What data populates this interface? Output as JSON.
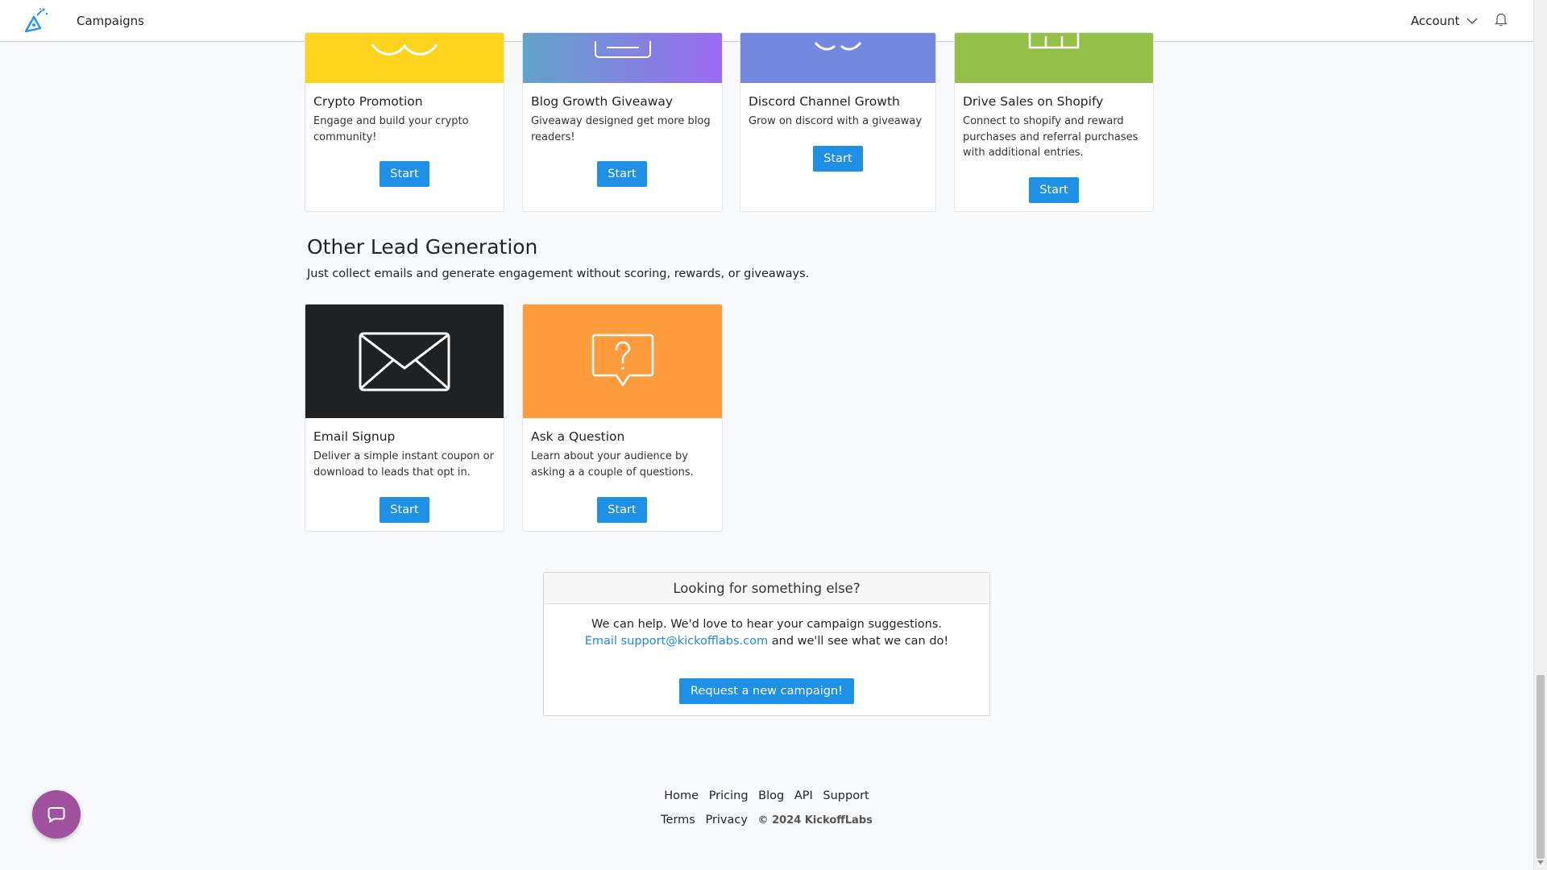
{
  "nav": {
    "campaigns": "Campaigns",
    "account": "Account"
  },
  "top_cards": [
    {
      "title": "Crypto Promotion",
      "desc": "Engage and build your crypto community!",
      "button": "Start",
      "color": "#fdd31c"
    },
    {
      "title": "Blog Growth Giveaway",
      "desc": "Giveaway designed get more blog readers!",
      "button": "Start",
      "color_from": "#62a3c9",
      "color_to": "#9b6bf2"
    },
    {
      "title": "Discord Channel Growth",
      "desc": "Grow on discord with a giveaway",
      "button": "Start",
      "color": "#7389e0"
    },
    {
      "title": "Drive Sales on Shopify",
      "desc": "Connect to shopify and reward purchases and referral purchases with additional entries.",
      "button": "Start",
      "color": "#95c047"
    }
  ],
  "lead_section": {
    "title": "Other Lead Generation",
    "subtitle": "Just collect emails and generate engagement without scoring, rewards, or giveaways."
  },
  "lead_cards": [
    {
      "title": "Email Signup",
      "desc": "Deliver a simple instant coupon or download to leads that opt in.",
      "button": "Start",
      "color": "#1f2123",
      "icon": "envelope-icon"
    },
    {
      "title": "Ask a Question",
      "desc": "Learn about your audience by asking a a couple of questions.",
      "button": "Start",
      "color": "#fe9b3d",
      "icon": "question-bubble-icon"
    }
  ],
  "help": {
    "heading": "Looking for something else?",
    "line1": "We can help. We'd love to hear your campaign suggestions.",
    "link": "Email support@kickofflabs.com",
    "line2_rest": " and we'll see what we can do!",
    "button": "Request a new campaign!"
  },
  "footer": {
    "links1": [
      "Home",
      "Pricing",
      "Blog",
      "API",
      "Support"
    ],
    "links2": [
      "Terms",
      "Privacy"
    ],
    "copyright": "© 2024 KickoffLabs"
  },
  "colors": {
    "primary": "#1e90e6",
    "chat": "#a0519e"
  }
}
